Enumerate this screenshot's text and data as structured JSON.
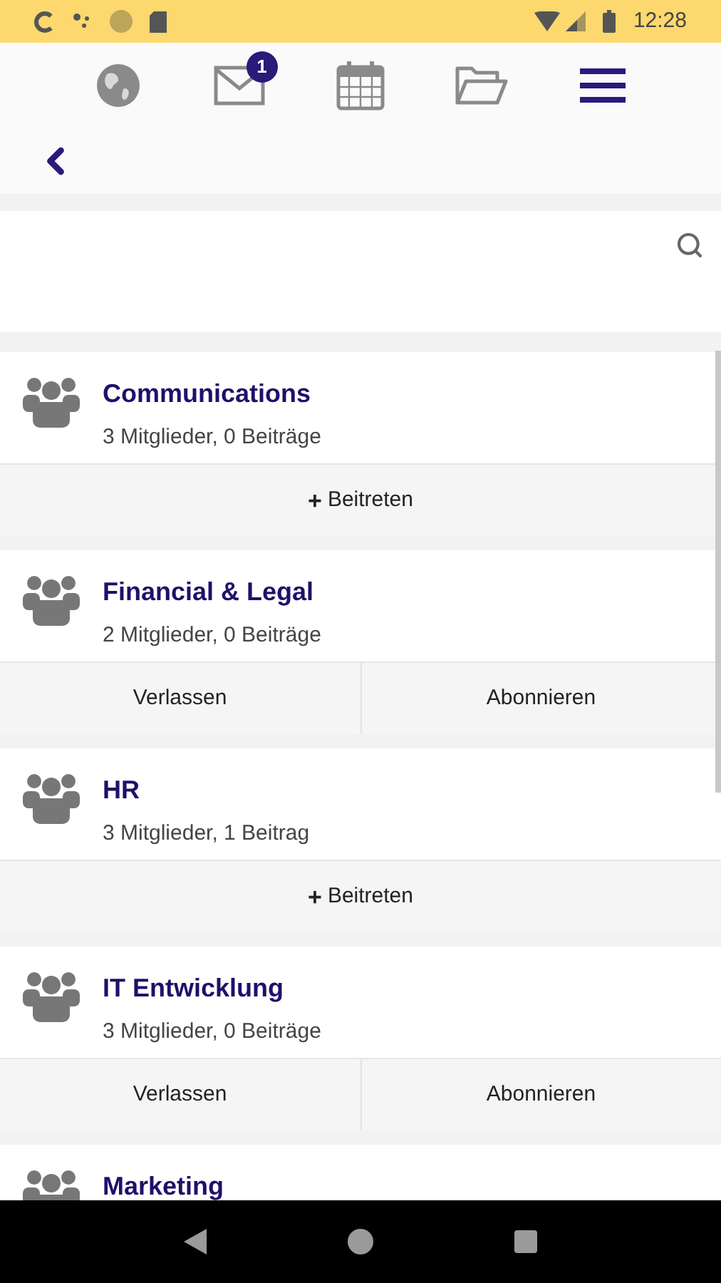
{
  "status_bar": {
    "time": "12:28"
  },
  "nav": {
    "items": [
      {
        "kind": "globe",
        "selected": false
      },
      {
        "kind": "mail",
        "selected": false,
        "badge": "1"
      },
      {
        "kind": "calendar",
        "selected": false
      },
      {
        "kind": "folder",
        "selected": false
      },
      {
        "kind": "menu",
        "selected": true
      }
    ]
  },
  "groups": [
    {
      "name": "Communications",
      "stats": "3 Mitglieder, 0 Beiträge",
      "actions": [
        {
          "kind": "join",
          "label": "Beitreten",
          "icon": "+"
        }
      ]
    },
    {
      "name": "Financial & Legal",
      "stats": "2 Mitglieder, 0 Beiträge",
      "actions": [
        {
          "kind": "plain",
          "label": "Verlassen"
        },
        {
          "kind": "plain",
          "label": "Abonnieren"
        }
      ]
    },
    {
      "name": "HR",
      "stats": "3 Mitglieder, 1 Beitrag",
      "actions": [
        {
          "kind": "join",
          "label": "Beitreten",
          "icon": "+"
        }
      ]
    },
    {
      "name": "IT Entwicklung",
      "stats": "3 Mitglieder, 0 Beiträge",
      "actions": [
        {
          "kind": "plain",
          "label": "Verlassen"
        },
        {
          "kind": "plain",
          "label": "Abonnieren"
        }
      ]
    },
    {
      "name": "Marketing"
    }
  ]
}
